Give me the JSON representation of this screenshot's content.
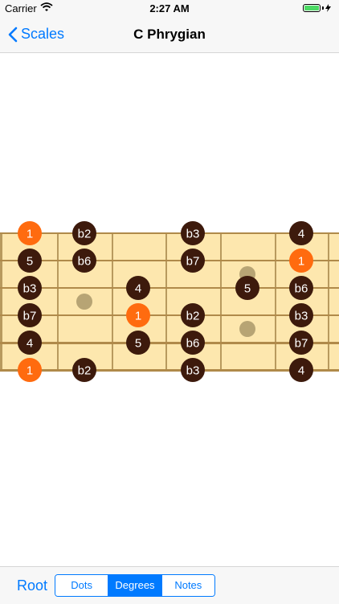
{
  "status_bar": {
    "carrier": "Carrier",
    "time": "2:27 AM"
  },
  "nav": {
    "back_label": "Scales",
    "title": "C Phrygian"
  },
  "fretboard": {
    "notes": [
      {
        "string": 1,
        "fret": 0,
        "label": "1",
        "root": true
      },
      {
        "string": 1,
        "fret": 1,
        "label": "b2",
        "root": false
      },
      {
        "string": 1,
        "fret": 3,
        "label": "b3",
        "root": false
      },
      {
        "string": 1,
        "fret": 5,
        "label": "4",
        "root": false
      },
      {
        "string": 2,
        "fret": 0,
        "label": "5",
        "root": false
      },
      {
        "string": 2,
        "fret": 1,
        "label": "b6",
        "root": false
      },
      {
        "string": 2,
        "fret": 3,
        "label": "b7",
        "root": false
      },
      {
        "string": 2,
        "fret": 5,
        "label": "1",
        "root": true
      },
      {
        "string": 3,
        "fret": 0,
        "label": "b3",
        "root": false
      },
      {
        "string": 3,
        "fret": 2,
        "label": "4",
        "root": false
      },
      {
        "string": 3,
        "fret": 4,
        "label": "5",
        "root": false
      },
      {
        "string": 3,
        "fret": 5,
        "label": "b6",
        "root": false
      },
      {
        "string": 4,
        "fret": 0,
        "label": "b7",
        "root": false
      },
      {
        "string": 4,
        "fret": 2,
        "label": "1",
        "root": true
      },
      {
        "string": 4,
        "fret": 3,
        "label": "b2",
        "root": false
      },
      {
        "string": 4,
        "fret": 5,
        "label": "b3",
        "root": false
      },
      {
        "string": 5,
        "fret": 0,
        "label": "4",
        "root": false
      },
      {
        "string": 5,
        "fret": 2,
        "label": "5",
        "root": false
      },
      {
        "string": 5,
        "fret": 3,
        "label": "b6",
        "root": false
      },
      {
        "string": 5,
        "fret": 5,
        "label": "b7",
        "root": false
      },
      {
        "string": 6,
        "fret": 0,
        "label": "1",
        "root": true
      },
      {
        "string": 6,
        "fret": 1,
        "label": "b2",
        "root": false
      },
      {
        "string": 6,
        "fret": 3,
        "label": "b3",
        "root": false
      },
      {
        "string": 6,
        "fret": 5,
        "label": "4",
        "root": false
      }
    ],
    "inlays": [
      {
        "fret": 1,
        "between": [
          3,
          4
        ]
      },
      {
        "fret": 4,
        "between": [
          2,
          3
        ]
      },
      {
        "fret": 4,
        "between": [
          4,
          5
        ]
      }
    ],
    "colors": {
      "wood": "#fde7ae",
      "fret_line": "#b89a5e",
      "string": "#b08a4a",
      "note": "#3d1a0c",
      "root": "#ff6b0f",
      "inlay": "#b7a474"
    }
  },
  "bottom_bar": {
    "root_label": "Root",
    "segments": [
      "Dots",
      "Degrees",
      "Notes"
    ],
    "selected_segment": "Degrees"
  }
}
